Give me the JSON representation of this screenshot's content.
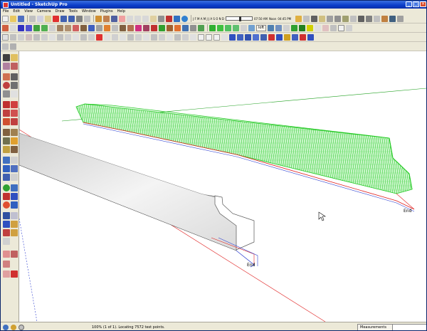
{
  "window": {
    "title": "Untitled - SketchUp Pro"
  },
  "menu": [
    "File",
    "Edit",
    "View",
    "Camera",
    "Draw",
    "Tools",
    "Window",
    "Plugins",
    "Help"
  ],
  "toolbar": {
    "shadow_months": "J F M A M J J A S O N D",
    "shadow_time": "07:50 AM",
    "shadow_noon": "Noon",
    "shadow_end": "04:45 PM",
    "loft_label": "loft"
  },
  "viewport": {
    "end_label_1": "End",
    "end_label_2": "End"
  },
  "status": {
    "message": "100% (1 of 1). Locating 7572 test points.",
    "measurements_label": "Measurements",
    "measurements_value": ""
  },
  "colors": {
    "green_mesh": "#22cc22",
    "red_axis": "#e02020",
    "blue_axis": "#2030e0",
    "green_axis": "#20a020"
  }
}
